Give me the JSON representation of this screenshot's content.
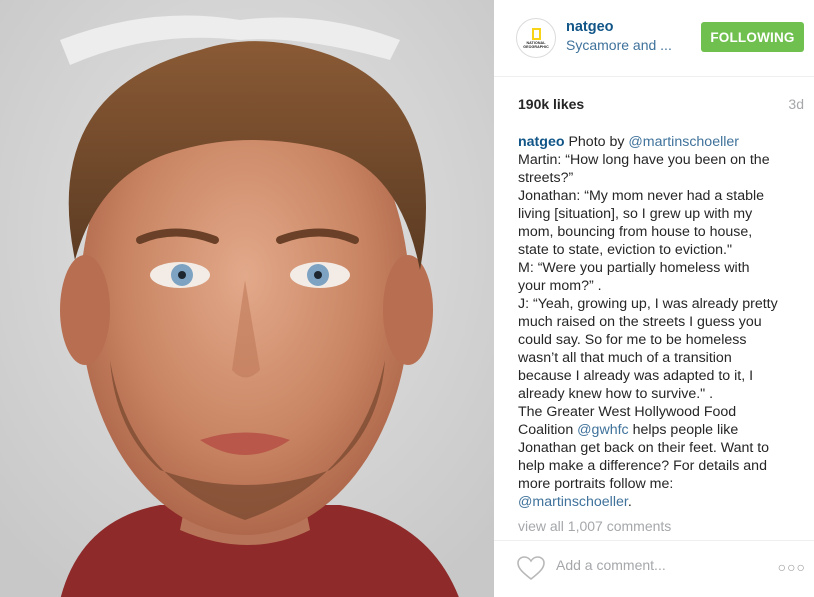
{
  "post": {
    "username": "natgeo",
    "location": "Sycamore and ...",
    "follow_label": "FOLLOWING",
    "likes": "190k likes",
    "time": "3d",
    "caption": {
      "user": "natgeo",
      "l1": " Photo by ",
      "l1_mention": "@martinschoeller",
      "l2": "Martin: “How long have you been on the",
      "l3": "streets?”",
      "l4": "Jonathan: “My mom never had a stable",
      "l5": "living [situation], so I grew up with my",
      "l6": "mom, bouncing from house to house,",
      "l7": "state to state, eviction to eviction.\"",
      "l8": "M: “Were you partially homeless with",
      "l9": "your mom?” .",
      "l10": "J: “Yeah, growing up, I was already pretty",
      "l11": "much raised on the streets I guess you",
      "l12": "could say. So for me to be homeless",
      "l13": "wasn’t all that much of a transition",
      "l14": "because I already was adapted to it, I",
      "l15": "already knew how to survive.\" .",
      "l16": "The Greater West Hollywood Food",
      "l17_a": "Coalition ",
      "l17_mention": "@gwhfc",
      "l17_b": " helps people like",
      "l18": "Jonathan get back on their feet. Want to",
      "l19": "help make a difference? For details and",
      "l20": "more portraits follow me:",
      "l21_mention": "@martinschoeller",
      "l21_b": "."
    },
    "view_all": "view all 1,007 comments",
    "comment_placeholder": "Add a comment...",
    "more_label": "○○○",
    "avatar_logo_text": "NATIONAL GEOGRAPHIC",
    "colors": {
      "follow_button": "#70c050",
      "username": "#125688",
      "link": "#3f729b",
      "muted": "#a5a7aa"
    }
  }
}
